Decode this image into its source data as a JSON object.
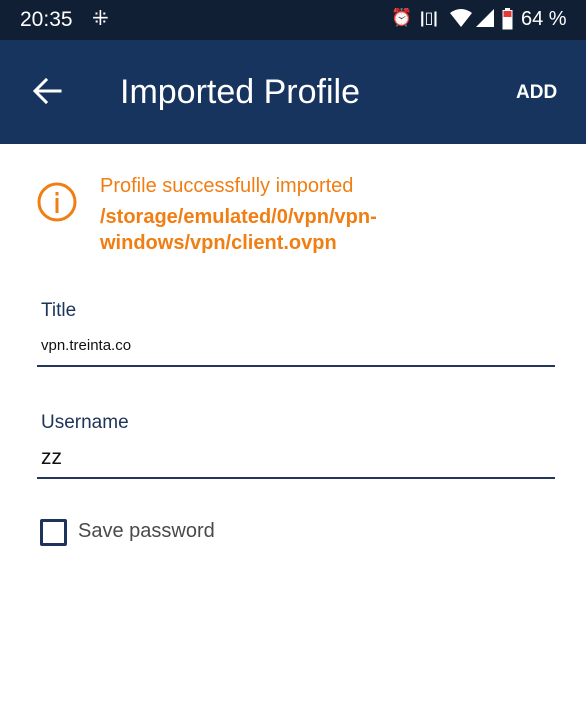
{
  "status_bar": {
    "time": "20:35",
    "battery_percent": "64 %",
    "background": "#111f35"
  },
  "app_bar": {
    "title": "Imported Profile",
    "action_label": "ADD",
    "background": "#17345f"
  },
  "info": {
    "message": "Profile successfully imported",
    "path": "/storage/emulated/0/vpn/vpn-windows/vpn/client.ovpn",
    "color": "#f07e13"
  },
  "form": {
    "title_label": "Title",
    "title_value": "vpn.treinta.co",
    "username_label": "Username",
    "username_value": "zz",
    "save_password_label": "Save password",
    "save_password_checked": false
  }
}
